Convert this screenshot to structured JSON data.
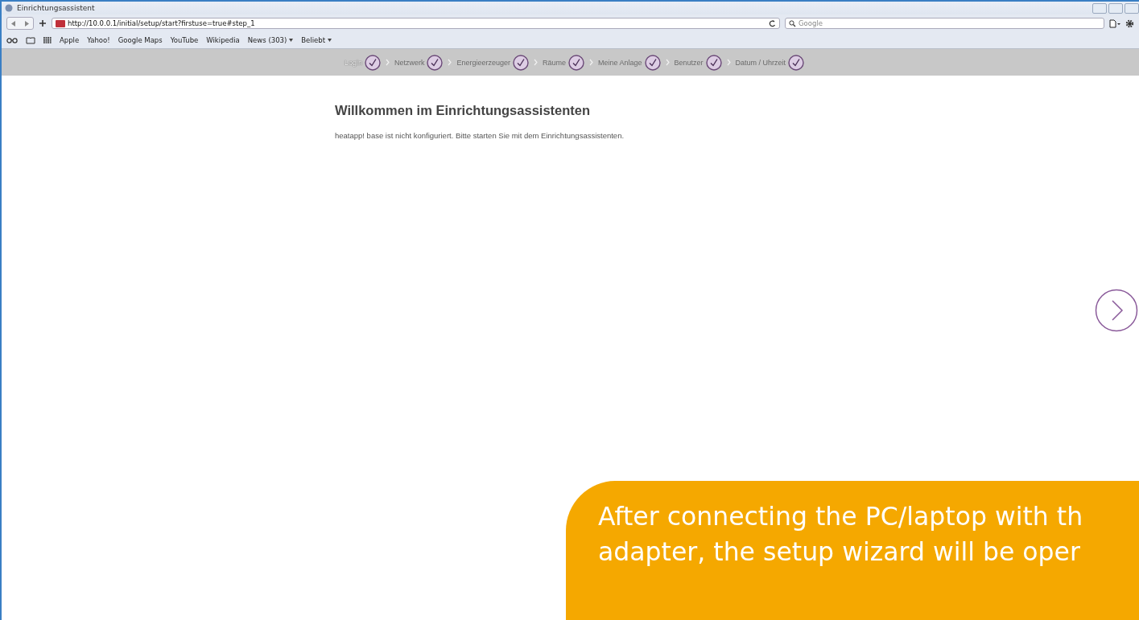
{
  "window": {
    "title": "Einrichtungsassistent"
  },
  "toolbar": {
    "url": "http://10.0.0.1/initial/setup/start?firstuse=true#step_1",
    "search_placeholder": "Google"
  },
  "bookmarks": [
    {
      "label": "Apple",
      "menu": false
    },
    {
      "label": "Yahoo!",
      "menu": false
    },
    {
      "label": "Google Maps",
      "menu": false
    },
    {
      "label": "YouTube",
      "menu": false
    },
    {
      "label": "Wikipedia",
      "menu": false
    },
    {
      "label": "News (303)",
      "menu": true
    },
    {
      "label": "Beliebt",
      "menu": true
    }
  ],
  "steps": [
    {
      "label": "Login",
      "selected": true
    },
    {
      "label": "Netzwerk",
      "selected": false
    },
    {
      "label": "Energieerzeuger",
      "selected": false
    },
    {
      "label": "Räume",
      "selected": false
    },
    {
      "label": "Meine Anlage",
      "selected": false
    },
    {
      "label": "Benutzer",
      "selected": false
    },
    {
      "label": "Datum / Uhrzeit",
      "selected": false
    }
  ],
  "content": {
    "heading": "Willkommen im Einrichtungsassistenten",
    "text": "heatapp! base ist nicht konfiguriert. Bitte starten Sie mit dem Einrichtungsassistenten."
  },
  "callout": {
    "lines": [
      "After connecting the PC/laptop with th",
      "adapter, the setup wizard will be oper"
    ]
  }
}
